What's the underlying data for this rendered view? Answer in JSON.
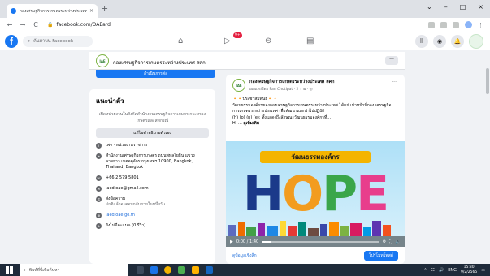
{
  "browser": {
    "tab_title": "กองเศรษฐกิจการเกษตรระหว่างประเทศ",
    "tab_close": "×",
    "new_tab": "+",
    "window_minimize": "⌄",
    "window_restore": "–",
    "window_maximize": "□",
    "window_close": "×",
    "back": "←",
    "forward": "→",
    "reload": "C",
    "url": "facebook.com/OAEard"
  },
  "fb_header": {
    "search_placeholder": "ค้นหาบน Facebook",
    "notification_count": "9+"
  },
  "page": {
    "name": "กองเศรษฐกิจการเกษตรระหว่างประเทศ สศก.",
    "logo_text": "IAE",
    "more_label": "···",
    "cta_label": "ลำเนินการต่อ"
  },
  "intro": {
    "heading": "แนะนำตัว",
    "description": "เปิดหน่วยงานในสังกัดสำนักงานเศรษฐกิจการเกษตร กระทรวงเกษตรและสหกรณ์",
    "edit_button": "แก้ไขคำอธิบายตัวเอง",
    "items": [
      {
        "icon": "i",
        "text": "เพจ · หน่วยงานราชการ",
        "sub": ""
      },
      {
        "icon": "⌖",
        "text": "สำนักงานเศรษฐกิจการเกษตร ถนนพหลโยธิน แขวงลาดยาว เขตจตุจักร กรุงเทพฯ",
        "sub": "10900, Bangkok, Thailand, Bangkok"
      },
      {
        "icon": "☏",
        "text": "+66 2 579 5801",
        "sub": ""
      },
      {
        "icon": "✉",
        "text": "iaed.oae@gmail.com",
        "sub": ""
      },
      {
        "icon": "✆",
        "text": "ส่งข้อความ",
        "sub": "ปกติแล้วจะตอบกลับภายในหนึ่งวัน"
      },
      {
        "icon": "⊕",
        "text": "iaed.oae.go.th",
        "sub": "",
        "link": true
      },
      {
        "icon": "★",
        "text": "ยังไม่มีคะแนน (0 รีวิว)",
        "sub": ""
      }
    ]
  },
  "post": {
    "author": "กองเศรษฐกิจการเกษตรระหว่างประเทศ สศก",
    "meta": "เผยแพร่โดย Pan Chotipat · 2 ราย · ◎",
    "more": "···",
    "line1": "🔸🔸ประชาสัมพันธ์🔸🔸",
    "line2": "วัฒนธรรมองค์กรของกองเศรษฐกิจการเกษตรระหว่างประเทศ ได้แก่ เข้าหน้าที่กอง เศรษฐกิจการเกษตรระหว่างประเทศ เพื่อพัฒนาและนำไปปฏิบัติ",
    "line3": "(h) (o) (p) (e): ทั้งแสดงถึงลักษณะวัฒนธรรมองค์กรที่...",
    "line4_prefix": "H: ...",
    "see_more": "ดูเพิ่มเติม",
    "poster_title": "วัฒนธรรมองค์กร",
    "hope_letters": [
      "H",
      "O",
      "P",
      "E"
    ],
    "video_time": "0:00 / 1:40",
    "video_progress": 0.08,
    "stats_link": "ดูข้อมูลเชิงลึก",
    "promote_button": "โปรโมทโพสต์"
  },
  "taskbar": {
    "search_placeholder": "พิมพ์ที่นี่เพื่อค้นหา",
    "tray_lang": "ENG",
    "time": "15:30",
    "date": "9/2/2565"
  },
  "colors": {
    "fb_blue": "#1877f2",
    "notification_red": "#e41e3f",
    "poster_banner": "#f4b400"
  }
}
